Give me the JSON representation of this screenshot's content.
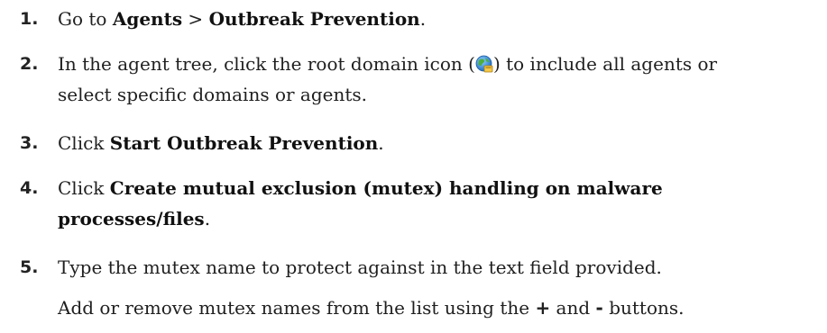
{
  "steps": [
    {
      "number": "1.",
      "prefix": "Go to ",
      "bold1": "Agents",
      "sep": " > ",
      "bold2": "Outbreak Prevention",
      "suffix": "."
    },
    {
      "number": "2.",
      "line1_before_icon": "In the agent tree, click the root domain icon (",
      "line1_after_icon": ") to include all agents or",
      "line2": "select specific domains or agents.",
      "icon": "root-domain-globe-icon"
    },
    {
      "number": "3.",
      "prefix": "Click ",
      "bold": "Start Outbreak Prevention",
      "suffix": "."
    },
    {
      "number": "4.",
      "prefix": "Click ",
      "bold_line1": "Create mutual exclusion (mutex) handling on malware",
      "bold_line2": "processes/files",
      "suffix": "."
    },
    {
      "number": "5.",
      "text": "Type the mutex name to protect against in the text field provided."
    }
  ],
  "note": {
    "prefix": "Add or remove mutex names from the list using the ",
    "plus": "+",
    "middle": " and ",
    "minus": "-",
    "suffix": " buttons."
  }
}
